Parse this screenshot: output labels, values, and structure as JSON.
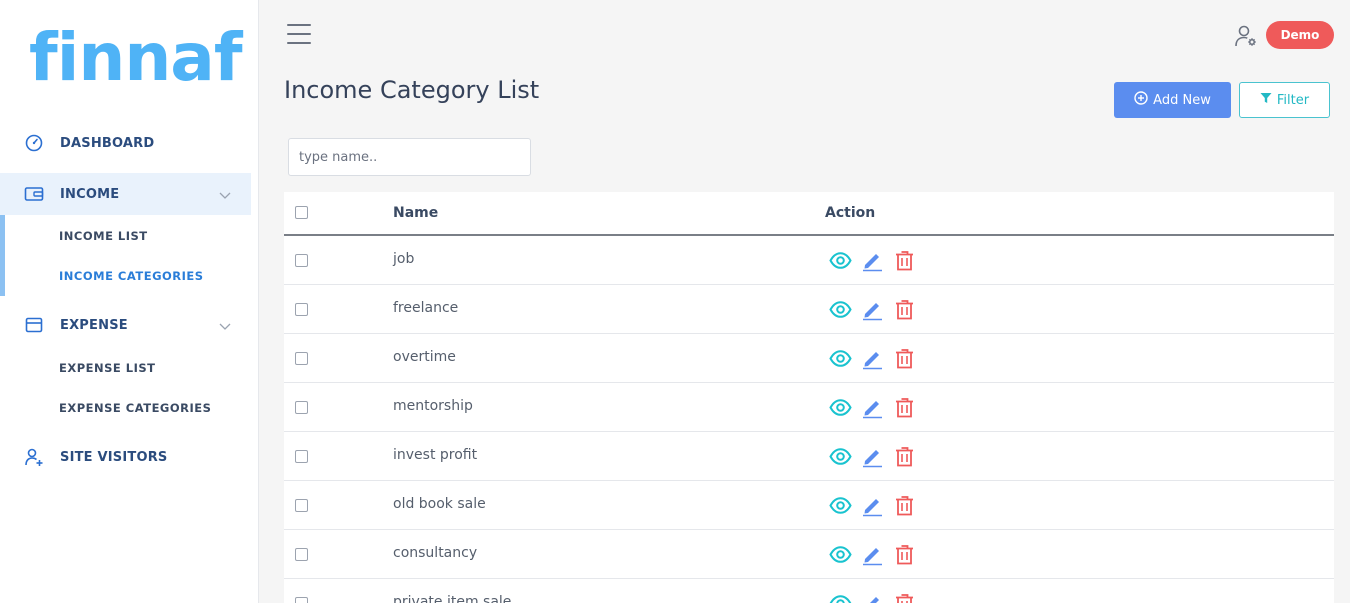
{
  "brand": {
    "logo_text": "finnaf",
    "color": "#4fb3f6"
  },
  "sidebar": {
    "items": [
      {
        "label": "DASHBOARD",
        "icon": "speedometer-icon"
      },
      {
        "label": "INCOME",
        "icon": "wallet-icon",
        "expanded": true,
        "active": true
      },
      {
        "label": "EXPENSE",
        "icon": "card-icon",
        "expanded": false
      },
      {
        "label": "SITE VISITORS",
        "icon": "user-plus-icon"
      }
    ],
    "income_sub": [
      {
        "label": "INCOME LIST"
      },
      {
        "label": "INCOME CATEGORIES",
        "current": true
      }
    ],
    "expense_sub": [
      {
        "label": "EXPENSE LIST"
      },
      {
        "label": "EXPENSE CATEGORIES"
      }
    ]
  },
  "topbar": {
    "badge_label": "Demo",
    "menu_icon": "hamburger-icon",
    "user_icon": "user-settings-icon"
  },
  "page": {
    "title": "Income Category List",
    "add_label": "Add New",
    "filter_label": "Filter",
    "search_placeholder": "type name.."
  },
  "table": {
    "headers": {
      "name": "Name",
      "action": "Action"
    },
    "rows": [
      {
        "name": "job"
      },
      {
        "name": "freelance"
      },
      {
        "name": "overtime"
      },
      {
        "name": "mentorship"
      },
      {
        "name": "invest profit"
      },
      {
        "name": "old book sale"
      },
      {
        "name": "consultancy"
      },
      {
        "name": "private item sale"
      }
    ]
  },
  "colors": {
    "primary": "#5b8def",
    "accent": "#22b8c4",
    "danger": "#ef5a5a",
    "view": "#19c3cf",
    "edit": "#5b8def"
  }
}
